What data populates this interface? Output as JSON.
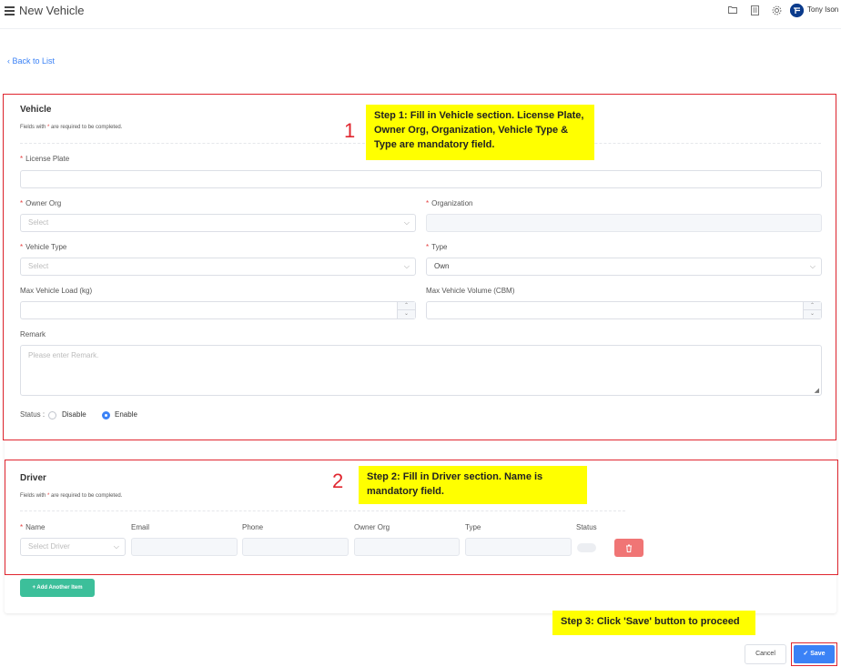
{
  "header": {
    "title": "New Vehicle",
    "user_name": "Tony Ison",
    "icons": [
      "folder-icon",
      "document-icon",
      "gear-icon"
    ]
  },
  "nav": {
    "back_label": "Back to List"
  },
  "vehicle": {
    "title": "Vehicle",
    "required_note_prefix": "Fields with ",
    "required_note_suffix": " are required to be completed.",
    "license_plate_label": "License Plate",
    "owner_org_label": "Owner Org",
    "owner_org_placeholder": "Select",
    "organization_label": "Organization",
    "vehicle_type_label": "Vehicle Type",
    "vehicle_type_placeholder": "Select",
    "type_label": "Type",
    "type_value": "Own",
    "max_load_label": "Max Vehicle Load (kg)",
    "max_volume_label": "Max Vehicle Volume (CBM)",
    "remark_label": "Remark",
    "remark_placeholder": "Please enter Remark.",
    "status_label": "Status :",
    "status_disable": "Disable",
    "status_enable": "Enable",
    "status_selected": "Enable"
  },
  "driver": {
    "title": "Driver",
    "required_note_prefix": "Fields with ",
    "required_note_suffix": " are required to be completed.",
    "columns": {
      "name": "Name",
      "email": "Email",
      "phone": "Phone",
      "owner_org": "Owner Org",
      "type": "Type",
      "status": "Status"
    },
    "name_placeholder": "Select Driver",
    "add_label": "+ Add Another Item"
  },
  "annotations": {
    "step1_number": "1",
    "step1_text": "Step 1: Fill in Vehicle section. License Plate, Owner Org, Organization, Vehicle Type & Type are mandatory field.",
    "step2_number": "2",
    "step2_text": "Step 2: Fill in Driver section. Name is mandatory field.",
    "step3_text": "Step 3: Click 'Save' button to proceed"
  },
  "footer": {
    "cancel_label": "Cancel",
    "save_label": "Save"
  },
  "colors": {
    "accent": "#3b82f6",
    "add_button": "#3cbf9a",
    "delete_button": "#f07575",
    "annotation_frame": "#e0262f",
    "callout": "#ffff00"
  }
}
